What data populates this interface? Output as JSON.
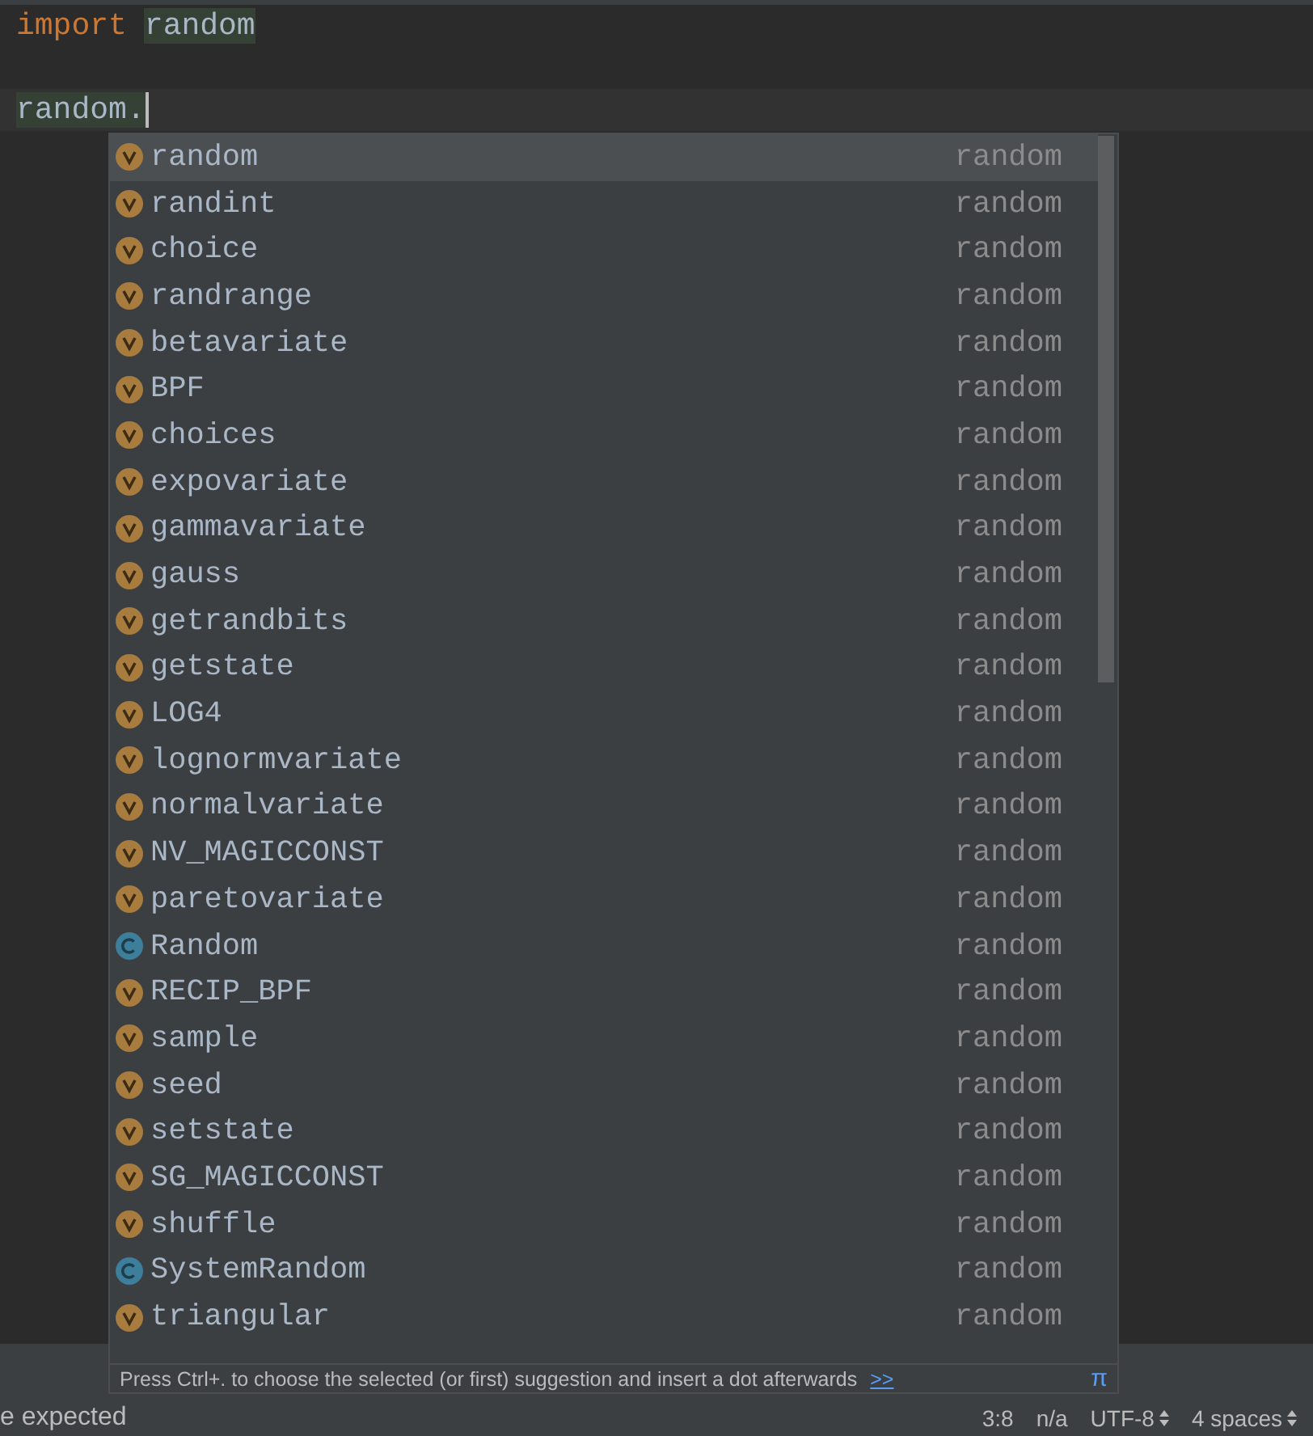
{
  "editor": {
    "lines": [
      {
        "current": false,
        "tokens": [
          {
            "kind": "keyword",
            "text": "import"
          },
          {
            "kind": "module",
            "text": "random"
          }
        ]
      },
      {
        "current": false
      },
      {
        "current": true,
        "tokens": [
          {
            "kind": "module",
            "text": "random."
          }
        ]
      }
    ]
  },
  "completion": {
    "items": [
      {
        "kind": "variable",
        "label": "random",
        "type": "random",
        "selected": true
      },
      {
        "kind": "variable",
        "label": "randint",
        "type": "random",
        "selected": false
      },
      {
        "kind": "variable",
        "label": "choice",
        "type": "random",
        "selected": false
      },
      {
        "kind": "variable",
        "label": "randrange",
        "type": "random",
        "selected": false
      },
      {
        "kind": "variable",
        "label": "betavariate",
        "type": "random",
        "selected": false
      },
      {
        "kind": "variable",
        "label": "BPF",
        "type": "random",
        "selected": false
      },
      {
        "kind": "variable",
        "label": "choices",
        "type": "random",
        "selected": false
      },
      {
        "kind": "variable",
        "label": "expovariate",
        "type": "random",
        "selected": false
      },
      {
        "kind": "variable",
        "label": "gammavariate",
        "type": "random",
        "selected": false
      },
      {
        "kind": "variable",
        "label": "gauss",
        "type": "random",
        "selected": false
      },
      {
        "kind": "variable",
        "label": "getrandbits",
        "type": "random",
        "selected": false
      },
      {
        "kind": "variable",
        "label": "getstate",
        "type": "random",
        "selected": false
      },
      {
        "kind": "variable",
        "label": "LOG4",
        "type": "random",
        "selected": false
      },
      {
        "kind": "variable",
        "label": "lognormvariate",
        "type": "random",
        "selected": false
      },
      {
        "kind": "variable",
        "label": "normalvariate",
        "type": "random",
        "selected": false
      },
      {
        "kind": "variable",
        "label": "NV_MAGICCONST",
        "type": "random",
        "selected": false
      },
      {
        "kind": "variable",
        "label": "paretovariate",
        "type": "random",
        "selected": false
      },
      {
        "kind": "class",
        "label": "Random",
        "type": "random",
        "selected": false
      },
      {
        "kind": "variable",
        "label": "RECIP_BPF",
        "type": "random",
        "selected": false
      },
      {
        "kind": "variable",
        "label": "sample",
        "type": "random",
        "selected": false
      },
      {
        "kind": "variable",
        "label": "seed",
        "type": "random",
        "selected": false
      },
      {
        "kind": "variable",
        "label": "setstate",
        "type": "random",
        "selected": false
      },
      {
        "kind": "variable",
        "label": "SG_MAGICCONST",
        "type": "random",
        "selected": false
      },
      {
        "kind": "variable",
        "label": "shuffle",
        "type": "random",
        "selected": false
      },
      {
        "kind": "class",
        "label": "SystemRandom",
        "type": "random",
        "selected": false
      },
      {
        "kind": "variable",
        "label": "triangular",
        "type": "random",
        "selected": false
      }
    ],
    "hint": {
      "text": "Press Ctrl+. to choose the selected (or first) suggestion and insert a dot afterwards",
      "link": ">>",
      "symbol": "π"
    }
  },
  "status_bar": {
    "message": "e expected",
    "items": [
      "3:8",
      "n/a",
      "UTF-8",
      "4 spaces"
    ]
  }
}
